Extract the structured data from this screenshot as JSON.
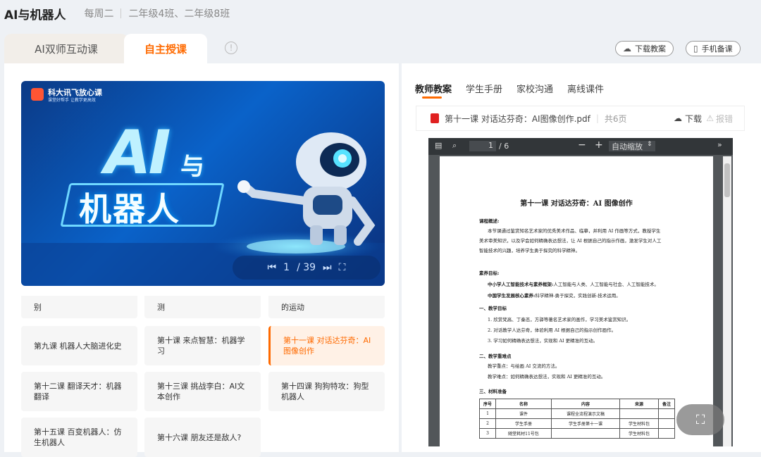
{
  "header": {
    "app_title": "AI与机器人",
    "day": "每周二",
    "classes": "二年级4班、二年级8班"
  },
  "tabs": {
    "ai_dual": "AI双师互动课",
    "self_teach": "自主授课"
  },
  "toolbar": {
    "download_plan": "下载教案",
    "mobile_prep": "手机备课"
  },
  "banner": {
    "brand": "科大讯飞放心课",
    "brand_sub": "课堂好帮手 让教学更高效",
    "title_ai": "AI",
    "title_yu": "与",
    "title_robot": "机器人",
    "page_current": "1",
    "page_total": "/ 39"
  },
  "lessons": [
    {
      "label": "别"
    },
    {
      "label": "测"
    },
    {
      "label": "的运动"
    },
    {
      "label": "第九课 机器人大脑进化史"
    },
    {
      "label": "第十课 来点智慧：机器学习"
    },
    {
      "label": "第十一课 对话达芬奇：AI图像创作",
      "active": true
    },
    {
      "label": "第十二课 翻译天才：机器翻译"
    },
    {
      "label": "第十三课 挑战李白：AI文本创作"
    },
    {
      "label": "第十四课 狗狗特攻：狗型机器人"
    },
    {
      "label": "第十五课 百变机器人：仿生机器人"
    },
    {
      "label": "第十六课 朋友还是敌人?"
    }
  ],
  "right_tabs": [
    "教师教案",
    "学生手册",
    "家校沟通",
    "离线课件"
  ],
  "file": {
    "name": "第十一课 对话达芬奇：AI图像创作.pdf",
    "pages": "共6页",
    "download": "下载",
    "report": "报错"
  },
  "viewer": {
    "page_input": "1",
    "page_total": "/ 6",
    "zoom": "自动缩放"
  },
  "doc": {
    "title": "第十一课 对话达芬奇：AI 图像创作",
    "overview_h": "课程概述:",
    "overview_1": "本节课通过鉴赏知名艺术家的优秀美术作品、临摹，并利用 AI 作画等方式，教授学生",
    "overview_2": "美术审美知识，以及学会如何精确表达想法，让 AI 根据自己的指示作画，激发学生对人工",
    "overview_3": "智能技术的兴趣，培养学生勇于探究的科学精神。",
    "lit_h": "素养目标:",
    "lit_1a": "中小学人工智能技术与素养框架:",
    "lit_1b": "人工智能与人类、人工智能与社会、人工智能技术。",
    "lit_2a": "中国学生发展核心素养:",
    "lit_2b": "科学精神-勇于探究，实践创新-技术运用。",
    "goal_h": "一、教学目标",
    "goal_1": "1. 欣赏梵高、丁秦忞，方驿等著名艺术家的画作，学习美术鉴赏知识。",
    "goal_2": "2. 对话教学人达芬奇，体验利用 AI 根据自己的指示创作画作。",
    "goal_3": "3. 学习如何精确表达想法，实现和 AI 更精准的互动。",
    "key_h": "二、教学重难点",
    "key_1": "教学重点：与绘画 AI 交流的方法。",
    "key_2": "教学难点：如何精确表达想法，实现和 AI 更精准的互动。",
    "mat_h": "三、材料准备",
    "table_header": [
      "序号",
      "名称",
      "内容",
      "来源",
      "备注"
    ],
    "table_rows": [
      [
        "1",
        "课件",
        "课程全流程演示文稿",
        "",
        ""
      ],
      [
        "2",
        "学生手册",
        "学生手册第十一课",
        "学生材料包",
        ""
      ],
      [
        "3",
        "随堂耗材11号包",
        "",
        "学生材料包",
        ""
      ]
    ]
  }
}
